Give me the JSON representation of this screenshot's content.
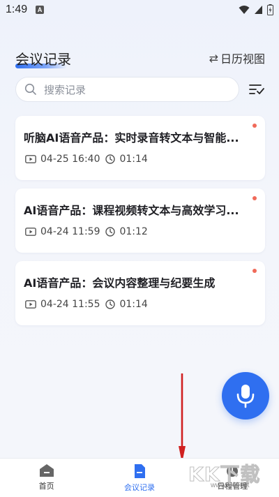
{
  "status_bar": {
    "time": "1:49",
    "notification_glyph": "A"
  },
  "header": {
    "title": "会议记录",
    "calendar_link": "日历视图"
  },
  "search": {
    "placeholder": "搜索记录"
  },
  "records": [
    {
      "title": "听脑AI语音产品：实时录音转文本与智能...",
      "date": "04-25 16:40",
      "duration": "01:14",
      "unread": true
    },
    {
      "title": "AI语音产品：课程视频转文本与高效学习...",
      "date": "04-24 11:59",
      "duration": "01:12",
      "unread": true
    },
    {
      "title": "AI语音产品：会议内容整理与纪要生成",
      "date": "04-24 11:55",
      "duration": "01:14",
      "unread": true
    }
  ],
  "bottom_nav": [
    {
      "label": "首页",
      "icon": "home-icon",
      "active": false
    },
    {
      "label": "会议记录",
      "icon": "document-icon",
      "active": true
    },
    {
      "label": "日程管理",
      "icon": "schedule-icon",
      "active": false
    }
  ],
  "watermark": {
    "text": "KK下载",
    "url": "www.kkx.net"
  },
  "colors": {
    "accent": "#2f6ff0",
    "unread_dot": "#f06a5a",
    "arrow": "#d02020"
  }
}
